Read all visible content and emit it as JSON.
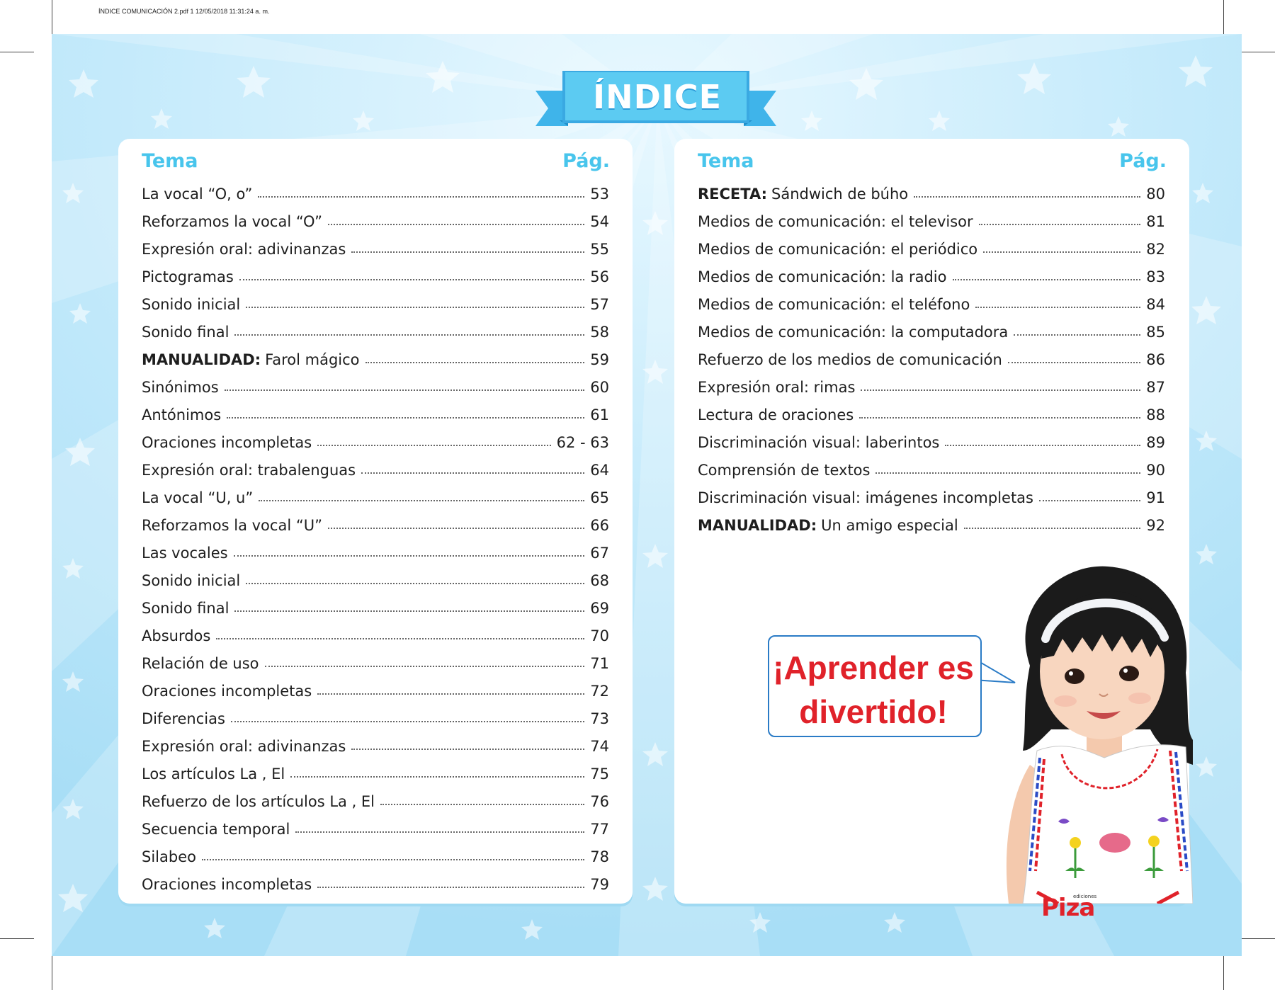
{
  "file_header": "ÍNDICE COMUNICACIÓN 2.pdf   1   12/05/2018   11:31:24 a. m.",
  "title": "ÍNDICE",
  "left": {
    "tema_label": "Tema",
    "pag_label": "Pág.",
    "items": [
      {
        "bold": "",
        "text": "La vocal “O, o”",
        "page": "53"
      },
      {
        "bold": "",
        "text": "Reforzamos la vocal “O”",
        "page": "54"
      },
      {
        "bold": "",
        "text": "Expresión oral: adivinanzas",
        "page": "55"
      },
      {
        "bold": "",
        "text": "Pictogramas",
        "page": "56"
      },
      {
        "bold": "",
        "text": "Sonido inicial",
        "page": "57"
      },
      {
        "bold": "",
        "text": "Sonido final",
        "page": "58"
      },
      {
        "bold": "MANUALIDAD:",
        "text": "Farol mágico",
        "page": "59"
      },
      {
        "bold": "",
        "text": "Sinónimos",
        "page": "60"
      },
      {
        "bold": "",
        "text": "Antónimos",
        "page": "61"
      },
      {
        "bold": "",
        "text": "Oraciones incompletas",
        "page": "62 - 63"
      },
      {
        "bold": "",
        "text": "Expresión oral: trabalenguas",
        "page": "64"
      },
      {
        "bold": "",
        "text": "La vocal “U, u”",
        "page": "65"
      },
      {
        "bold": "",
        "text": "Reforzamos la vocal “U”",
        "page": "66"
      },
      {
        "bold": "",
        "text": "Las vocales",
        "page": "67"
      },
      {
        "bold": "",
        "text": "Sonido inicial",
        "page": "68"
      },
      {
        "bold": "",
        "text": "Sonido final",
        "page": "69"
      },
      {
        "bold": "",
        "text": "Absurdos",
        "page": "70"
      },
      {
        "bold": "",
        "text": "Relación de uso",
        "page": "71"
      },
      {
        "bold": "",
        "text": "Oraciones incompletas",
        "page": "72"
      },
      {
        "bold": "",
        "text": "Diferencias",
        "page": "73"
      },
      {
        "bold": "",
        "text": "Expresión oral: adivinanzas",
        "page": "74"
      },
      {
        "bold": "",
        "text": "Los artículos La , El",
        "page": "75"
      },
      {
        "bold": "",
        "text": "Refuerzo de los artículos La , El",
        "page": "76"
      },
      {
        "bold": "",
        "text": "Secuencia temporal",
        "page": "77"
      },
      {
        "bold": "",
        "text": "Silabeo",
        "page": "78"
      },
      {
        "bold": "",
        "text": "Oraciones incompletas",
        "page": "79"
      }
    ]
  },
  "right": {
    "tema_label": "Tema",
    "pag_label": "Pág.",
    "items": [
      {
        "bold": "RECETA:",
        "text": "Sándwich de búho",
        "page": "80"
      },
      {
        "bold": "",
        "text": "Medios de comunicación: el televisor",
        "page": "81"
      },
      {
        "bold": "",
        "text": "Medios de comunicación: el periódico",
        "page": "82"
      },
      {
        "bold": "",
        "text": "Medios de comunicación: la radio",
        "page": "83"
      },
      {
        "bold": "",
        "text": "Medios de comunicación: el teléfono",
        "page": "84"
      },
      {
        "bold": "",
        "text": "Medios de comunicación: la computadora",
        "page": "85"
      },
      {
        "bold": "",
        "text": "Refuerzo de los medios de comunicación",
        "page": "86"
      },
      {
        "bold": "",
        "text": "Expresión oral: rimas",
        "page": "87"
      },
      {
        "bold": "",
        "text": "Lectura de oraciones",
        "page": "88"
      },
      {
        "bold": "",
        "text": "Discriminación visual: laberintos",
        "page": "89"
      },
      {
        "bold": "",
        "text": "Comprensión de textos",
        "page": "90"
      },
      {
        "bold": "",
        "text": "Discriminación visual: imágenes incompletas",
        "page": "91"
      },
      {
        "bold": "MANUALIDAD:",
        "text": "Un amigo especial",
        "page": "92"
      }
    ]
  },
  "bubble": {
    "line1": "¡Aprender es",
    "line2": "divertido!"
  },
  "logo": {
    "small": "ediciones",
    "name": "Piza"
  },
  "colors": {
    "background": "#bfe8fa",
    "accent": "#48c5ec",
    "banner": "#5ccbf2",
    "bubble_text": "#e0222a"
  }
}
